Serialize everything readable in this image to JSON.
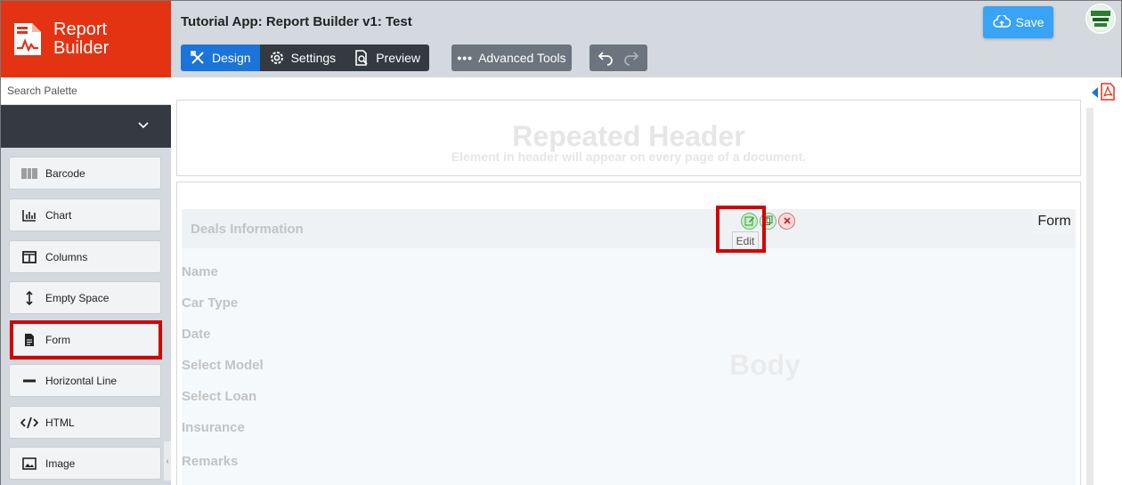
{
  "brand": {
    "name": "Report Builder",
    "line1": "Report",
    "line2": "Builder",
    "color": "#e43313"
  },
  "app": {
    "title": "Tutorial App: Report Builder v1: Test"
  },
  "tabs": [
    {
      "label": "Design",
      "icon": "design-icon",
      "active": true
    },
    {
      "label": "Settings",
      "icon": "gear-icon",
      "active": false
    },
    {
      "label": "Preview",
      "icon": "preview-icon",
      "active": false
    }
  ],
  "toolbar": {
    "advanced_label": "Advanced Tools",
    "save_label": "Save",
    "undo_icon": "undo-icon",
    "redo_icon": "redo-icon"
  },
  "sidebar": {
    "search_placeholder": "Search Palette",
    "items": [
      {
        "label": "Barcode",
        "icon": "barcode-icon"
      },
      {
        "label": "Chart",
        "icon": "chart-icon"
      },
      {
        "label": "Columns",
        "icon": "columns-icon"
      },
      {
        "label": "Empty Space",
        "icon": "vertical-arrows-icon"
      },
      {
        "label": "Form",
        "icon": "document-icon"
      },
      {
        "label": "Horizontal Line",
        "icon": "line-icon"
      },
      {
        "label": "HTML",
        "icon": "code-icon"
      },
      {
        "label": "Image",
        "icon": "image-icon"
      }
    ]
  },
  "canvas": {
    "header_title": "Repeated Header",
    "header_subtitle": "Element in header will appear on every page of a document.",
    "body_watermark": "Body",
    "form": {
      "title": "Deals Information",
      "tag": "Form",
      "fields": [
        "Name",
        "Car Type",
        "Date",
        "Select Model",
        "Select Loan",
        "Insurance",
        "Remarks"
      ],
      "edit_tooltip": "Edit"
    }
  },
  "colors": {
    "accent": "#1a74d9",
    "dark": "#343a40",
    "save": "#39a3f5",
    "highlight": "#d50000"
  }
}
